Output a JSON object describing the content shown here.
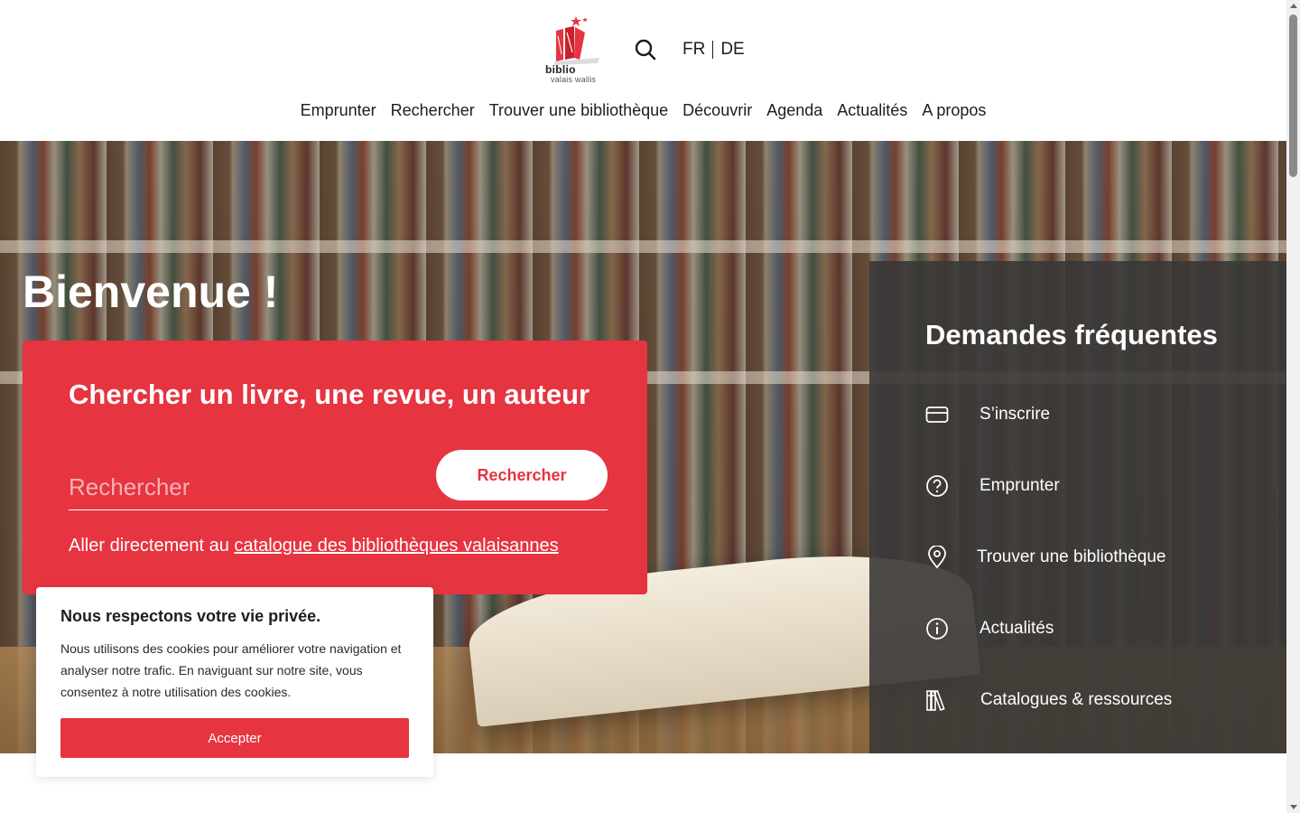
{
  "header": {
    "logo": {
      "line1": "biblio",
      "line2": "valais wallis"
    },
    "languages": [
      "FR",
      "DE"
    ],
    "nav": [
      "Emprunter",
      "Rechercher",
      "Trouver une bibliothèque",
      "Découvrir",
      "Agenda",
      "Actualités",
      "A propos"
    ]
  },
  "hero": {
    "title": "Bienvenue !",
    "search_card": {
      "title": "Chercher un livre, une revue, un auteur",
      "placeholder": "Rechercher",
      "button": "Rechercher",
      "link_prefix": "Aller directement au ",
      "link_text": "catalogue des bibliothèques valaisannes"
    },
    "faq": {
      "title": "Demandes fréquentes",
      "items": [
        {
          "label": "S’inscrire",
          "icon": "card-icon"
        },
        {
          "label": "Emprunter",
          "icon": "question-icon"
        },
        {
          "label": "Trouver une bibliothèque",
          "icon": "location-pin-icon"
        },
        {
          "label": "Actualités",
          "icon": "info-icon"
        },
        {
          "label": "Catalogues & ressources",
          "icon": "books-icon"
        }
      ]
    }
  },
  "cookie": {
    "title": "Nous respectons votre vie privée.",
    "text": "Nous utilisons des cookies pour améliorer votre navigation et analyser notre trafic. En naviguant sur notre site, vous consentez à notre utilisation des cookies.",
    "button": "Accepter"
  },
  "colors": {
    "brand_red": "#e63440",
    "faq_panel": "#3a3736"
  }
}
